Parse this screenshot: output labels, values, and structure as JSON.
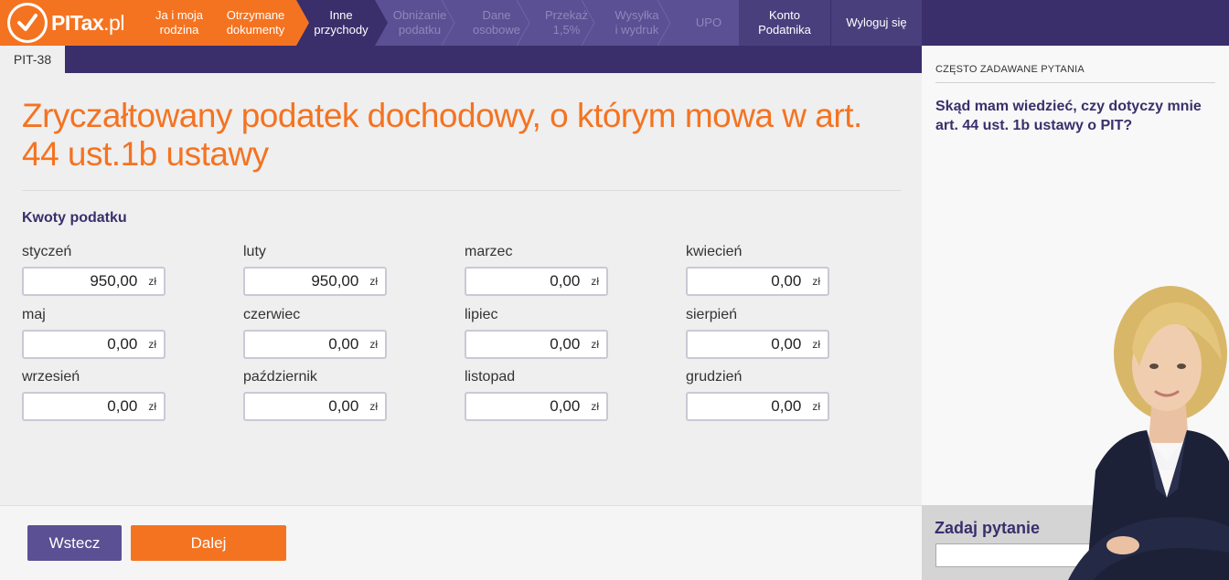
{
  "brand": {
    "name": "PITax",
    "tld": ".pl",
    "accent": "#f47321",
    "primary": "#3a2f6b"
  },
  "nav": {
    "steps": [
      {
        "label": "Ja i moja\nrodzina",
        "state": "done"
      },
      {
        "label": "Otrzymane\ndokumenty",
        "state": "done"
      },
      {
        "label": "Inne\nprzychody",
        "state": "current"
      },
      {
        "label": "Obniżanie\npodatku",
        "state": "future"
      },
      {
        "label": "Dane\nosobowe",
        "state": "future"
      },
      {
        "label": "Przekaż\n1,5%",
        "state": "future"
      },
      {
        "label": "Wysyłka\ni wydruk",
        "state": "future"
      },
      {
        "label": "UPO",
        "state": "future"
      }
    ],
    "account": "Konto\nPodatnika",
    "logout": "Wyloguj się"
  },
  "form_tab": "PIT-38",
  "page": {
    "title": "Zryczałtowany podatek dochodowy, o którym mowa w art. 44 ust.1b ustawy",
    "section": "Kwoty podatku",
    "currency": "zł",
    "months": [
      {
        "label": "styczeń",
        "value": "950,00"
      },
      {
        "label": "luty",
        "value": "950,00"
      },
      {
        "label": "marzec",
        "value": "0,00"
      },
      {
        "label": "kwiecień",
        "value": "0,00"
      },
      {
        "label": "maj",
        "value": "0,00"
      },
      {
        "label": "czerwiec",
        "value": "0,00"
      },
      {
        "label": "lipiec",
        "value": "0,00"
      },
      {
        "label": "sierpień",
        "value": "0,00"
      },
      {
        "label": "wrzesień",
        "value": "0,00"
      },
      {
        "label": "październik",
        "value": "0,00"
      },
      {
        "label": "listopad",
        "value": "0,00"
      },
      {
        "label": "grudzień",
        "value": "0,00"
      }
    ]
  },
  "footer": {
    "back": "Wstecz",
    "next": "Dalej"
  },
  "sidebar": {
    "faq_header": "CZĘSTO ZADAWANE PYTANIA",
    "faq_question": "Skąd mam wiedzieć, czy dotyczy mnie art. 44 ust. 1b ustawy o PIT?",
    "ask_label": "Zadaj pytanie",
    "ask_value": ""
  }
}
